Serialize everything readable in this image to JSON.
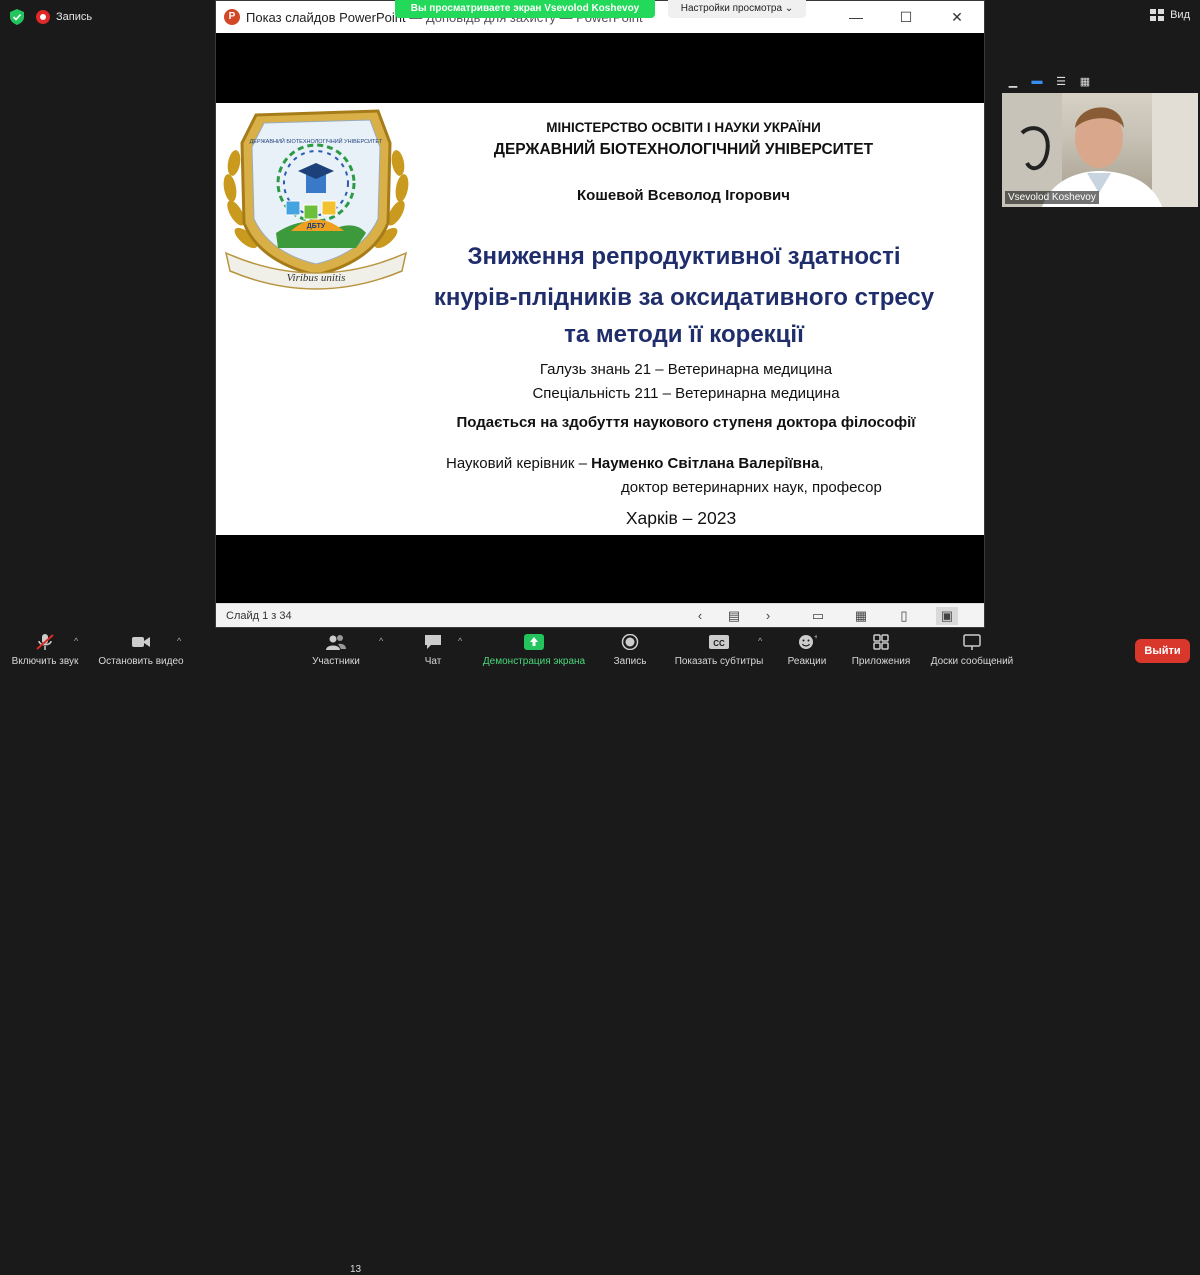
{
  "zoom": {
    "record_label": "Запись",
    "view_label": "Вид",
    "share_banner": "Вы просматриваете экран Vsevolod Koshevoy",
    "view_settings": "Настройки просмотра",
    "participant_name": "Vsevolod Koshevoy",
    "participant_count": "13",
    "toolbar": {
      "unmute": "Включить звук",
      "stop_video": "Остановить видео",
      "participants": "Участники",
      "chat": "Чат",
      "share_screen": "Демонстрация экрана",
      "record": "Запись",
      "captions": "Показать субтитры",
      "reactions": "Реакции",
      "apps": "Приложения",
      "whiteboards": "Доски сообщений",
      "leave": "Выйти"
    }
  },
  "powerpoint": {
    "window_title": "Показ слайдов PowerPoint",
    "window_title_rest": " — Доповідь для захисту — PowerPoint",
    "status": "Слайд 1 з 34"
  },
  "slide": {
    "ministry": "МІНІСТЕРСТВО ОСВІТИ І НАУКИ УКРАЇНИ",
    "university": "ДЕРЖАВНИЙ БІОТЕХНОЛОГІЧНИЙ УНІВЕРСИТЕТ",
    "author": "Кошевой Всеволод Ігорович",
    "title_line1": "Зниження репродуктивної здатності",
    "title_line2": "кнурів-плідників за оксидативного стресу",
    "title_line3": "та методи її корекції",
    "field": "Галузь знань 21 – Ветеринарна медицина",
    "specialty": "Спеціальність 211 – Ветеринарна медицина",
    "degree": "Подається на здобуття наукового ступеня доктора філософії",
    "supervisor_label": "Науковий керівник – ",
    "supervisor_name": "Науменко Світлана Валеріївна",
    "supervisor_comma": ",",
    "supervisor_title": "доктор ветеринарних наук, професор",
    "city_year": "Харків – 2023",
    "logo_motto": "Viribus unitis",
    "logo_arc": "ДЕРЖАВНИЙ БІОТЕХНОЛОГІЧНИЙ УНІВЕРСИТЕТ",
    "logo_abbr": "ДБТУ"
  }
}
